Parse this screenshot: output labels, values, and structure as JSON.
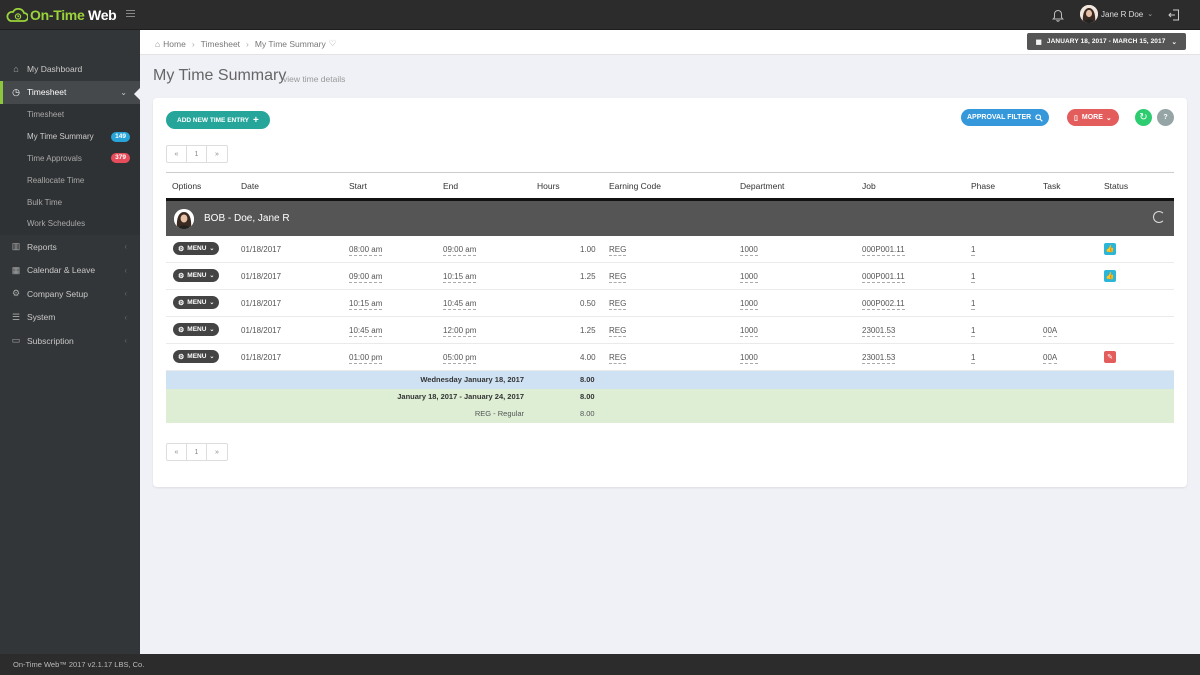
{
  "app": {
    "logo_prefix": "On-Time",
    "logo_suffix": "Web",
    "user_name": "Jane R Doe",
    "footer": "On-Time Web™ 2017 v2.1.17   LBS, Co."
  },
  "sidebar": {
    "items": [
      {
        "label": "My Dashboard",
        "icon": "home-icon"
      },
      {
        "label": "Timesheet",
        "icon": "clock-icon"
      },
      {
        "label": "Reports",
        "icon": "bar-chart-icon"
      },
      {
        "label": "Calendar & Leave",
        "icon": "calendar-icon"
      },
      {
        "label": "Company Setup",
        "icon": "cogs-icon"
      },
      {
        "label": "System",
        "icon": "list-icon"
      },
      {
        "label": "Subscription",
        "icon": "credit-card-icon"
      }
    ],
    "timesheet_sub": [
      {
        "label": "Timesheet"
      },
      {
        "label": "My Time Summary",
        "badge": "149"
      },
      {
        "label": "Time Approvals",
        "badge": "379"
      },
      {
        "label": "Reallocate Time"
      },
      {
        "label": "Bulk Time"
      },
      {
        "label": "Work Schedules"
      }
    ]
  },
  "breadcrumb": {
    "home": "Home",
    "timesheet": "Timesheet",
    "current": "My Time Summary"
  },
  "date_range": "JANUARY 18, 2017 - MARCH 15, 2017",
  "page": {
    "title": "My Time Summary",
    "subtitle": "view time details"
  },
  "toolbar": {
    "add_label": "ADD NEW TIME ENTRY",
    "approval_label": "APPROVAL FILTER",
    "more_label": "MORE",
    "help_label": "?"
  },
  "pager": {
    "prev": "«",
    "page": "1",
    "next": "»"
  },
  "table": {
    "headers": [
      "Options",
      "Date",
      "Start",
      "End",
      "Hours",
      "Earning Code",
      "Department",
      "Job",
      "Phase",
      "Task",
      "Status"
    ],
    "group_name": "BOB - Doe, Jane R",
    "menu_label": "MENU",
    "rows": [
      {
        "date": "01/18/2017",
        "start": "08:00 am",
        "end": "09:00 am",
        "hours": "1.00",
        "code": "REG",
        "dept": "1000",
        "job": "000P001.11",
        "phase": "1",
        "task": "",
        "status": "approved"
      },
      {
        "date": "01/18/2017",
        "start": "09:00 am",
        "end": "10:15 am",
        "hours": "1.25",
        "code": "REG",
        "dept": "1000",
        "job": "000P001.11",
        "phase": "1",
        "task": "",
        "status": "approved"
      },
      {
        "date": "01/18/2017",
        "start": "10:15 am",
        "end": "10:45 am",
        "hours": "0.50",
        "code": "REG",
        "dept": "1000",
        "job": "000P002.11",
        "phase": "1",
        "task": "",
        "status": ""
      },
      {
        "date": "01/18/2017",
        "start": "10:45 am",
        "end": "12:00 pm",
        "hours": "1.25",
        "code": "REG",
        "dept": "1000",
        "job": "23001.53",
        "phase": "1",
        "task": "00A",
        "status": ""
      },
      {
        "date": "01/18/2017",
        "start": "01:00 pm",
        "end": "05:00 pm",
        "hours": "4.00",
        "code": "REG",
        "dept": "1000",
        "job": "23001.53",
        "phase": "1",
        "task": "00A",
        "status": "edit"
      }
    ],
    "day_total_label": "Wednesday January 18, 2017",
    "day_total": "8.00",
    "period_label": "January 18, 2017  -  January 24, 2017",
    "period_total": "8.00",
    "code_label": "REG - Regular",
    "code_total": "8.00"
  },
  "colors": {
    "accent_green": "#8cc63f",
    "add_button": "#26a69a",
    "approval_button": "#3498db",
    "more_button": "#e35d5d",
    "day_total_bg": "#cfe2f3",
    "period_total_bg": "#ddeed5"
  }
}
